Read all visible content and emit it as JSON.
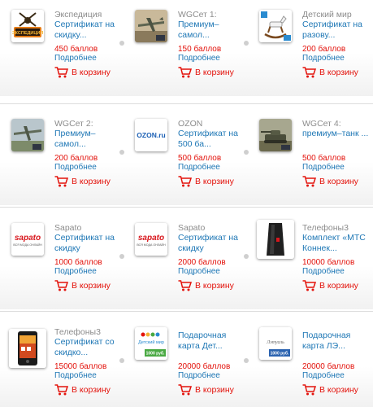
{
  "cart_label": "В корзину",
  "more_label": "Подробнее",
  "rows": [
    [
      {
        "vendor": "Экспедиция",
        "title": "Сертификат на скидку...",
        "price": "450 баллов"
      },
      {
        "vendor": "WGСет 1:",
        "title": "Премиум–самол...",
        "price": "150 баллов"
      },
      {
        "vendor": "Детский мир",
        "title": "Сертификат на разову...",
        "price": "200 баллов"
      }
    ],
    [
      {
        "vendor": "WGСет 2:",
        "title": "Премиум–самол...",
        "price": "200 баллов"
      },
      {
        "vendor": "OZON",
        "title": "Сертификат на 500 ба...",
        "price": "500 баллов"
      },
      {
        "vendor": "WGСет 4:",
        "title": "премиум–танк ...",
        "price": "500 баллов"
      }
    ],
    [
      {
        "vendor": "Sapato",
        "title": "Сертификат на скидку",
        "price": "1000 баллов"
      },
      {
        "vendor": "Sapato",
        "title": "Сертификат на скидку",
        "price": "2000 баллов"
      },
      {
        "vendor": "Телефоны3",
        "title": "Комплект «МТС Коннек...",
        "price": "10000 баллов"
      }
    ],
    [
      {
        "vendor": "Телефоны3",
        "title": "Сертификат со скидко...",
        "price": "15000 баллов"
      },
      {
        "vendor": "",
        "title": "Подарочная карта Дет...",
        "price": "20000 баллов"
      },
      {
        "vendor": "",
        "title": "Подарочная карта ЛЭ...",
        "price": "20000 баллов"
      }
    ]
  ],
  "logos": {
    "ozon": "OZON.ru",
    "sapato_brand": "sapato",
    "sapato_tag": "ВСЯ МОДА ОНЛАЙН",
    "detmir_text": "Детский мир",
    "card_value": "1000 руб.",
    "lette_text": "Лэтуаль",
    "expedition": "ЭКСПЕДИЦИЯ"
  },
  "colors": {
    "link": "#1e77b5",
    "price": "#e3120b",
    "vendor": "#8c8c8c",
    "ozon": "#1a5fb4",
    "sapato": "#d8161c"
  }
}
